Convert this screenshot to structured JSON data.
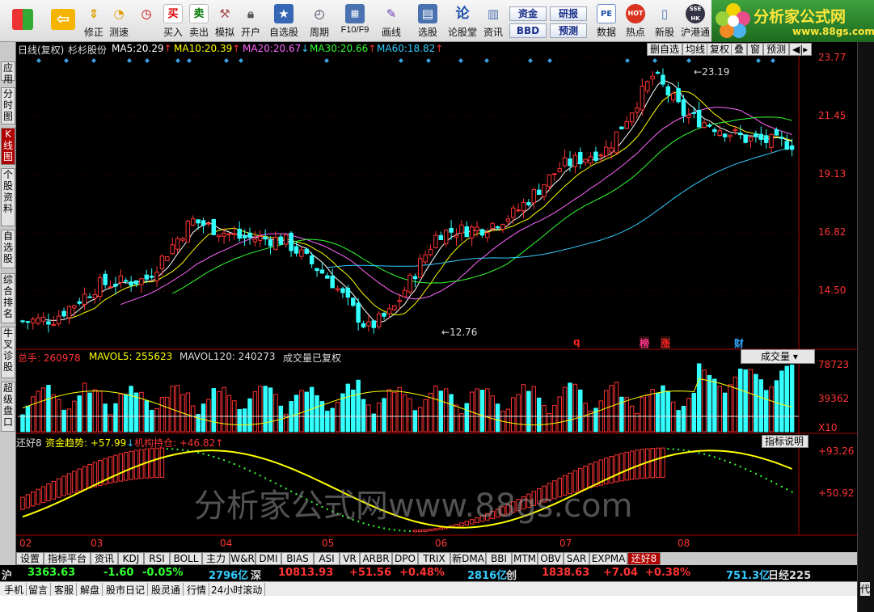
{
  "toolbar": {
    "buttons": [
      {
        "label": "",
        "icon": "windows-icon"
      },
      {
        "label": "",
        "icon": "back-arrow-icon"
      },
      {
        "label": "修正",
        "icon": "up-down-icon"
      },
      {
        "label": "测速",
        "icon": "speed-icon"
      },
      {
        "label": "买入",
        "icon": "buy-icon",
        "glyph": "买"
      },
      {
        "label": "卖出",
        "icon": "sell-icon",
        "glyph": "卖"
      },
      {
        "label": "模拟",
        "icon": "hammer-icon"
      },
      {
        "label": "开户",
        "icon": "lock-icon"
      },
      {
        "label": "自选股",
        "icon": "star-icon"
      },
      {
        "label": "周期",
        "icon": "clock-icon"
      },
      {
        "label": "F10/F9",
        "icon": "f10-icon"
      },
      {
        "label": "画线",
        "icon": "pen-icon"
      },
      {
        "label": "选股",
        "icon": "filter-icon"
      },
      {
        "label": "论股堂",
        "icon": "discuss-icon",
        "glyph": "论"
      },
      {
        "label": "资讯",
        "icon": "news-icon"
      },
      {
        "label": "数据",
        "icon": "pe-icon",
        "glyph": "PE"
      },
      {
        "label": "热点",
        "icon": "hot-icon",
        "glyph": "HOT"
      },
      {
        "label": "新股",
        "icon": "ipo-icon"
      },
      {
        "label": "沪港通",
        "icon": "sse-hk-icon",
        "glyph": "SSE HK"
      }
    ],
    "small_buttons": {
      "zijin": "资金",
      "bbd": "BBD",
      "yanbao": "研报",
      "yuce": "预测"
    },
    "logo_text": "分析家公式网",
    "logo_url": "www.88gs.com"
  },
  "left_tabs": [
    "应用",
    "分时图",
    "K线图",
    "个股资料",
    "自选股",
    "综合排名",
    "牛叉诊股",
    "超级盘口"
  ],
  "chart": {
    "period": "日线(复权)",
    "stock_name": "杉杉股份",
    "ma": [
      {
        "label": "MA5:",
        "value": "20.29",
        "arrow": "↑",
        "color": "#ffffff"
      },
      {
        "label": "MA10:",
        "value": "20.39",
        "arrow": "↑",
        "color": "#ffff00"
      },
      {
        "label": "MA20:",
        "value": "20.67",
        "arrow": "↓",
        "color": "#ff66ff"
      },
      {
        "label": "MA30:",
        "value": "20.66",
        "arrow": "↑",
        "color": "#33ff33"
      },
      {
        "label": "MA60:",
        "value": "18.82",
        "arrow": "↑",
        "color": "#33ccff"
      }
    ],
    "top_buttons": [
      "删自选",
      "均线",
      "复权",
      "叠",
      "窗",
      "预测"
    ],
    "price_labels": [
      "23.77",
      "21.45",
      "19.13",
      "16.82",
      "14.50"
    ],
    "high_label": "23.19",
    "low_label": "12.76",
    "markers": [
      {
        "text": "q",
        "color": "#ff2222"
      },
      {
        "text": "榜",
        "color": "#ff3388"
      },
      {
        "text": "涨",
        "color": "#ff2222"
      },
      {
        "text": "财",
        "color": "#33aaff"
      }
    ],
    "volume": {
      "total": "总手: 260978",
      "mavol5": "MAVOL5: 255623",
      "mavol120": "MAVOL120: 240273",
      "note": "成交量已复权",
      "selector": "成交量",
      "labels": [
        "78723",
        "39362"
      ],
      "unit": "X10"
    },
    "indicator": {
      "name": "还好8",
      "fund": "资金趋势: +57.99",
      "inst": "机构持仓: +46.82",
      "help": "指标说明",
      "labels": [
        "+93.26",
        "+50.92"
      ]
    },
    "months": [
      "02",
      "03",
      "04",
      "05",
      "06",
      "07",
      "08"
    ]
  },
  "bottom_tabs": [
    "设置",
    "指标平台",
    "资讯",
    "KDJ",
    "RSI",
    "BOLL",
    "主力",
    "W&R",
    "DMI",
    "BIAS",
    "ASI",
    "VR",
    "ARBR",
    "DPO",
    "TRIX",
    "新DMA",
    "BBI",
    "MTM",
    "OBV",
    "SAR",
    "EXPMA",
    "还好8"
  ],
  "status": {
    "sh_name": "沪",
    "sh_val": "3363.63",
    "sh_chg": "-1.60",
    "sh_pct": "-0.05%",
    "sh_amt": "2796亿",
    "sz_name": "深",
    "sz_val": "10813.93",
    "sz_chg": "+51.56",
    "sz_pct": "+0.48%",
    "sz_amt": "2816亿",
    "cy_name": "创",
    "cy_val": "1838.63",
    "cy_chg": "+7.04",
    "cy_pct": "+0.38%",
    "cy_amt": "751.3亿",
    "nk_name": "日经225"
  },
  "status2": [
    "手机",
    "留言",
    "客服",
    "解盘",
    "股市日记",
    "股灵通",
    "行情",
    "24小时滚动"
  ],
  "right_strip": "代",
  "watermark": "分析家公式网www.88gs.com"
}
